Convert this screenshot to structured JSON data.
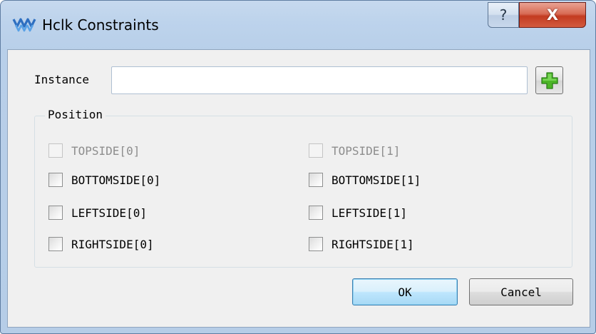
{
  "window": {
    "title": "Hclk Constraints",
    "help_glyph": "?",
    "close_glyph": "X",
    "title_icon": "app-logo-icon"
  },
  "instance": {
    "label": "Instance",
    "value": "",
    "add_icon": "plus-icon"
  },
  "position": {
    "title": "Position",
    "options": [
      {
        "label": "TOPSIDE[0]",
        "checked": false,
        "enabled": false
      },
      {
        "label": "TOPSIDE[1]",
        "checked": false,
        "enabled": false
      },
      {
        "label": "BOTTOMSIDE[0]",
        "checked": false,
        "enabled": true
      },
      {
        "label": "BOTTOMSIDE[1]",
        "checked": false,
        "enabled": true
      },
      {
        "label": "LEFTSIDE[0]",
        "checked": false,
        "enabled": true
      },
      {
        "label": "LEFTSIDE[1]",
        "checked": false,
        "enabled": true
      },
      {
        "label": "RIGHTSIDE[0]",
        "checked": false,
        "enabled": true
      },
      {
        "label": "RIGHTSIDE[1]",
        "checked": false,
        "enabled": true
      }
    ]
  },
  "buttons": {
    "ok": "OK",
    "cancel": "Cancel"
  },
  "colors": {
    "title_bar": "#bdd3ec",
    "close_button": "#c33b21",
    "dialog_body": "#f0f0f0",
    "plus_icon": "#4cb527",
    "default_button": "#3c7fb1"
  }
}
